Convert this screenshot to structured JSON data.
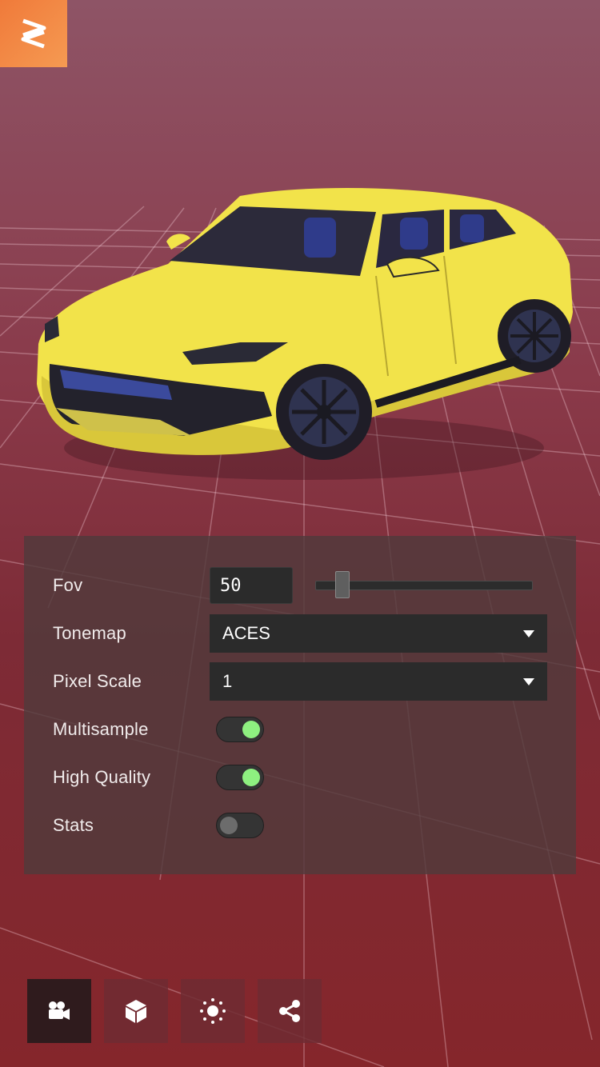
{
  "settings": {
    "fov": {
      "label": "Fov",
      "value": "50",
      "slider_fraction": 0.1
    },
    "tonemap": {
      "label": "Tonemap",
      "value": "ACES"
    },
    "pixel_scale": {
      "label": "Pixel Scale",
      "value": "1"
    },
    "multisample": {
      "label": "Multisample",
      "on": true
    },
    "high_quality": {
      "label": "High Quality",
      "on": true
    },
    "stats": {
      "label": "Stats",
      "on": false
    }
  },
  "toolbar": {
    "items": [
      {
        "icon": "video-camera-icon",
        "active": true
      },
      {
        "icon": "cube-icon",
        "active": false
      },
      {
        "icon": "sun-icon",
        "active": false
      },
      {
        "icon": "share-icon",
        "active": false
      }
    ]
  },
  "colors": {
    "brand_orange": "#f07a3a",
    "toggle_on": "#8ef080",
    "car_body": "#f2e34a"
  }
}
